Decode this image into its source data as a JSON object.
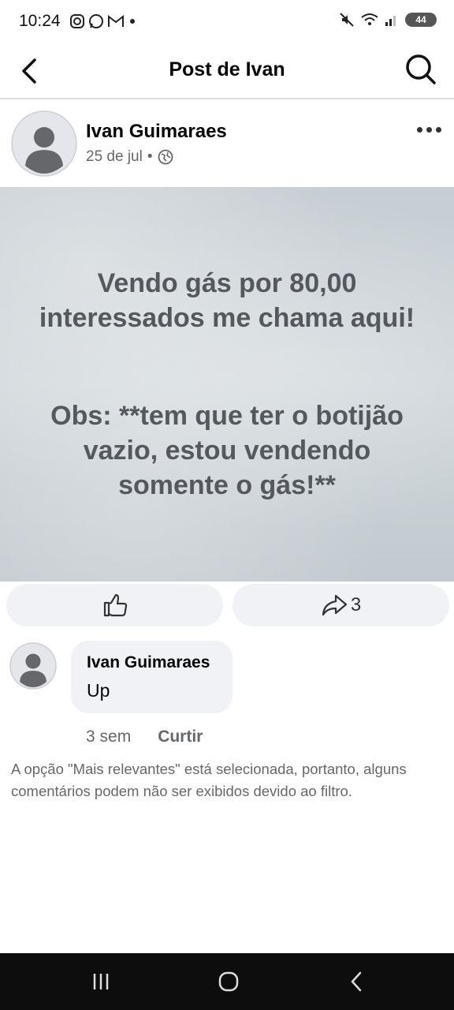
{
  "status_bar": {
    "time": "10:24",
    "battery": "44",
    "app_icons": [
      "instagram-icon",
      "whatsapp-icon",
      "gmail-icon",
      "dot-icon"
    ],
    "system_icons": [
      "mute-icon",
      "wifi-icon",
      "signal-icon",
      "battery-icon"
    ]
  },
  "appbar": {
    "title": "Post de Ivan"
  },
  "post": {
    "author": "Ivan Guimaraes",
    "date": "25 de jul",
    "separator": "•",
    "privacy_icon": "globe-icon",
    "image_text": {
      "line1": "Vendo gás por 80,00",
      "line2": "interessados me chama aqui!",
      "line3": "Obs: **tem que ter o botijão",
      "line4": "vazio, estou vendendo",
      "line5": "somente o gás!**"
    },
    "share_count": "3"
  },
  "comment": {
    "author": "Ivan Guimaraes",
    "text": "Up",
    "time": "3 sem",
    "like_label": "Curtir"
  },
  "notice": "A opção \"Mais relevantes\" está selecionada, portanto, alguns comentários podem não ser exibidos devido ao filtro.",
  "colors": {
    "accent_text": "#050505",
    "secondary_text": "#65676b",
    "button_bg": "#f0f2f5",
    "image_text": "#55595d",
    "navbar_bg": "#0d0d0d"
  }
}
